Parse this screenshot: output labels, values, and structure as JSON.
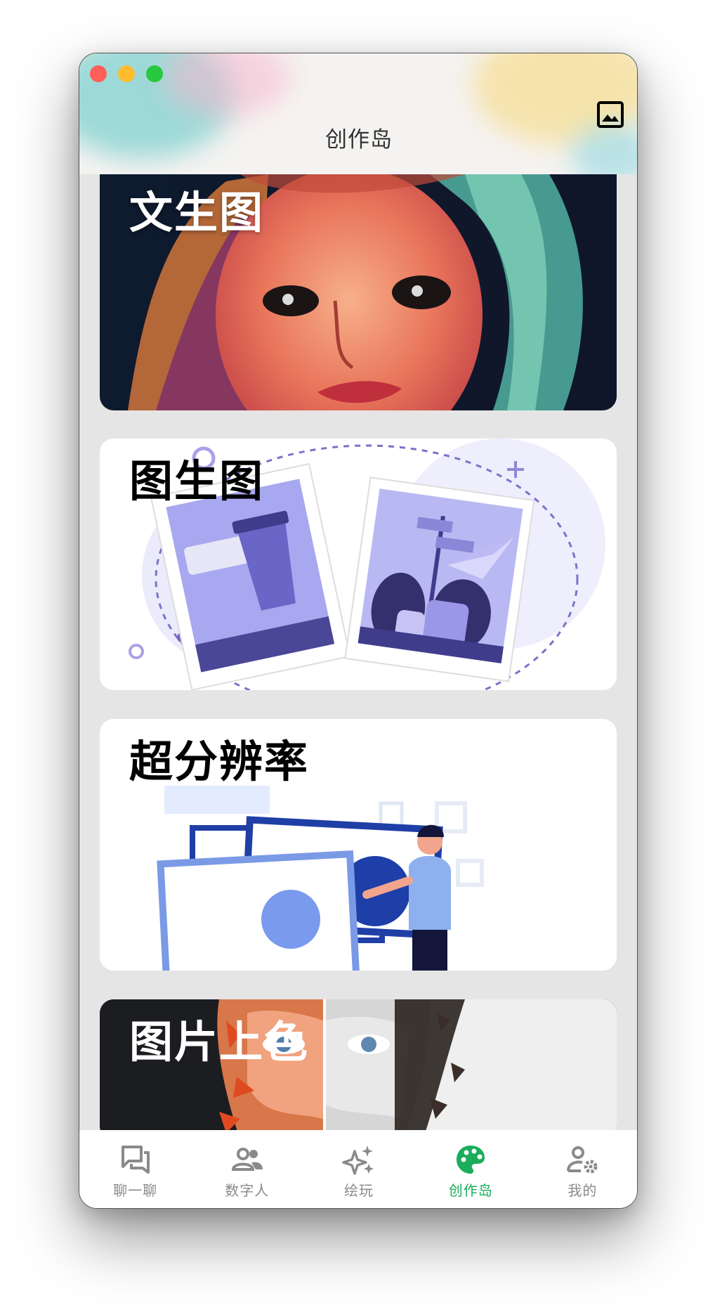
{
  "window": {
    "title": "创作岛",
    "controls": [
      "close",
      "minimize",
      "maximize"
    ],
    "header_action_icon": "image-icon"
  },
  "cards": [
    {
      "label": "文生图",
      "icon": "anime-portrait"
    },
    {
      "label": "图生图",
      "icon": "photo-frames-illustration"
    },
    {
      "label": "超分辨率",
      "icon": "upscale-illustration"
    },
    {
      "label": "图片上色",
      "icon": "colorize-portrait"
    }
  ],
  "tabbar": {
    "items": [
      {
        "label": "聊一聊",
        "icon": "chat-icon"
      },
      {
        "label": "数字人",
        "icon": "people-icon"
      },
      {
        "label": "绘玩",
        "icon": "sparkle-icon"
      },
      {
        "label": "创作岛",
        "icon": "palette-icon"
      },
      {
        "label": "我的",
        "icon": "user-settings-icon"
      }
    ],
    "active_index": 3
  },
  "colors": {
    "accent": "#1aad5a",
    "inactive": "#8a8a8a",
    "background": "#e5e5e5"
  }
}
